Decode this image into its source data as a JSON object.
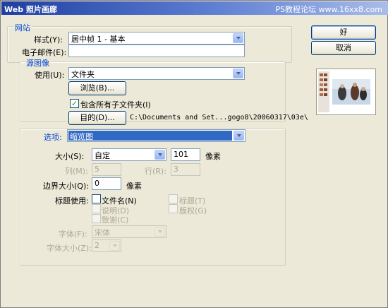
{
  "window": {
    "title": "Web 照片画廊",
    "watermark": "PS教程论坛 www.16xx8.com"
  },
  "site": {
    "legend": "网站",
    "style_label": "样式(Y):",
    "style_value": "居中帧 1 - 基本",
    "email_label": "电子邮件(E):",
    "email_value": ""
  },
  "source": {
    "legend": "源图像",
    "use_label": "使用(U):",
    "use_value": "文件夹",
    "browse_label": "浏览(B)...",
    "include_sub_label": "包含所有子文件夹(I)",
    "include_sub_checked": true,
    "dest_label": "目的(D)...",
    "dest_path": "C:\\Documents and Set...gogo8\\20060317\\03e\\"
  },
  "options": {
    "label": "选项:",
    "selected": "缩览图",
    "size_label": "大小(S):",
    "size_value": "自定",
    "size_num": "101",
    "px_unit": "像素",
    "cols_label": "列(M):",
    "cols_value": "5",
    "rows_label": "行(R):",
    "rows_value": "3",
    "border_label": "边界大小(Q):",
    "border_value": "0",
    "border_unit": "像素",
    "caption_label": "标题使用:",
    "filename_label": "文件名(N)",
    "title_label": "标题(T)",
    "desc_label": "说明(D)",
    "copyright_label": "版权(G)",
    "credits_label": "致谢(C)",
    "font_label": "字体(F):",
    "font_value": "宋体",
    "fontsize_label": "字体大小(Z):",
    "fontsize_value": "2"
  },
  "buttons": {
    "ok": "好",
    "cancel": "取消"
  }
}
